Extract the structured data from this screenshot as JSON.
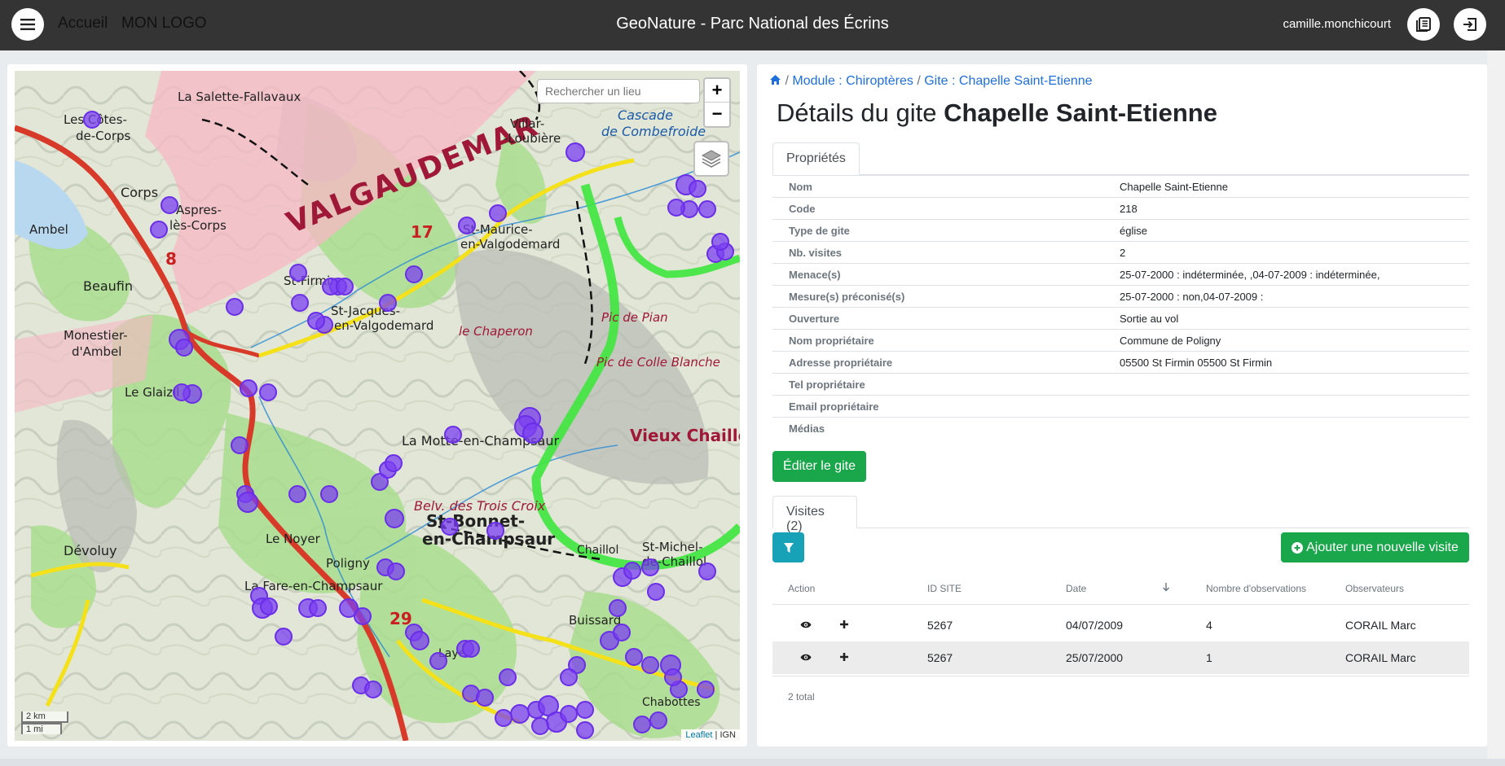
{
  "header": {
    "home_label": "Accueil",
    "logo_label": "MON LOGO",
    "app_title": "GeoNature - Parc National des Écrins",
    "username": "camille.monchicourt",
    "icons": {
      "menu": "hamburger-menu-icon",
      "docs": "book-icon",
      "logout": "logout-icon"
    }
  },
  "map": {
    "search_placeholder": "Rechercher un lieu",
    "zoom_in": "+",
    "zoom_out": "−",
    "scale_km": "2 km",
    "scale_mi": "1 mi",
    "attribution_leaflet": "Leaflet",
    "attribution_sep": "|",
    "attribution_ign": "IGN",
    "place_labels": [
      "VALGAUDEMAR",
      "La Salette-Fallavaux",
      "Les Côtes-de-Corps",
      "Corps",
      "Ambel",
      "Aspres-lès-Corps",
      "Beaufin",
      "Monestier-d'Ambel",
      "Le Glaizil",
      "St-Firmin",
      "St-Jacques-en-Valgodemard",
      "St-Maurice-en-Valgodemard",
      "Villar-Loubière",
      "Cascade de Combefroide",
      "La Motte-en-Champsaur",
      "St-Bonnet-en-Champsaur",
      "Dévoluy",
      "Poligny",
      "Le Noyer",
      "La Fare-en-Champsaur",
      "Chabottes",
      "Laye",
      "Buissard",
      "Vieux Chaillol",
      "Pic de Pian",
      "Pic de Colle Blanche",
      "le Chaperon",
      "Belv. des Trois Croix",
      "Chaillol",
      "St-Michel-de-Chaillol"
    ],
    "colors": {
      "observation_marker": "#7b3ff2",
      "park_boundary": "#3ee63e",
      "road_main": "#d83a2a",
      "road_secondary": "#f5e11a"
    }
  },
  "breadcrumb": {
    "home_icon": "home-icon",
    "sep1": "/",
    "module": "Module : Chiroptères",
    "sep2": "/",
    "gite": "Gite : Chapelle Saint-Etienne"
  },
  "title": {
    "prefix": "Détails du gite",
    "name": "Chapelle Saint-Etienne"
  },
  "properties_tab": "Propriétés",
  "properties": [
    {
      "key": "Nom",
      "value": "Chapelle Saint-Etienne"
    },
    {
      "key": "Code",
      "value": "218"
    },
    {
      "key": "Type de gite",
      "value": "église"
    },
    {
      "key": "Nb. visites",
      "value": "2"
    },
    {
      "key": "Menace(s)",
      "value": "25-07-2000 : indéterminée, ,04-07-2009 : indéterminée,"
    },
    {
      "key": "Mesure(s) préconisé(s)",
      "value": "25-07-2000 : non,04-07-2009 :"
    },
    {
      "key": "Ouverture",
      "value": "Sortie au vol"
    },
    {
      "key": "Nom propriétaire",
      "value": "Commune de Poligny"
    },
    {
      "key": "Adresse propriétaire",
      "value": "05500 St Firmin 05500 St Firmin"
    },
    {
      "key": "Tel propriétaire",
      "value": ""
    },
    {
      "key": "Email propriétaire",
      "value": ""
    },
    {
      "key": "Médias",
      "value": ""
    }
  ],
  "edit_button": "Éditer le gite",
  "visits_tab": "Visites (2)",
  "filter_icon": "filter-icon",
  "add_visit_button": "Ajouter une nouvelle visite",
  "grid": {
    "columns": [
      "Action",
      "ID SITE",
      "Date",
      "Nombre d'observations",
      "Observateurs"
    ],
    "sort_icon": "arrow-down-icon",
    "rows": [
      {
        "id_site": "5267",
        "date": "04/07/2009",
        "nb_obs": "4",
        "observers": "CORAIL Marc"
      },
      {
        "id_site": "5267",
        "date": "25/07/2000",
        "nb_obs": "1",
        "observers": "CORAIL Marc"
      }
    ],
    "total": "2 total"
  }
}
